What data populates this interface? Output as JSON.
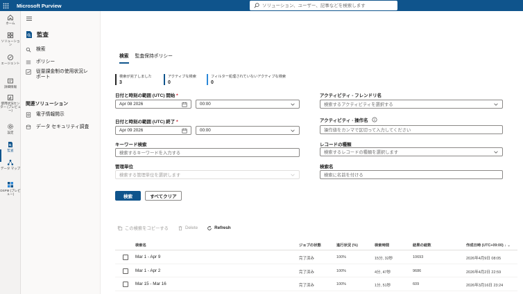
{
  "app": {
    "title": "Microsoft Purview"
  },
  "search": {
    "placeholder": "ソリューション、ユーザー、記事などを検索します"
  },
  "rail": [
    {
      "label": "ホーム",
      "icon": "home-icon"
    },
    {
      "label": "ソリューション",
      "icon": "solutions-icon"
    },
    {
      "label": "エージェント",
      "icon": "agent-icon"
    },
    {
      "label": "詳細情報",
      "icon": "learn-icon"
    },
    {
      "label": "使用状況センター (プレビュー)",
      "icon": "usage-icon"
    },
    {
      "label": "設定",
      "icon": "settings-icon"
    },
    {
      "label": "監査",
      "icon": "audit-icon"
    },
    {
      "label": "データ マップ",
      "icon": "data-map-icon"
    },
    {
      "label": "DSPM (プレビュー)",
      "icon": "dspm-icon"
    }
  ],
  "nav": {
    "title": "監査",
    "items": [
      "検索",
      "ポリシー",
      "従量課金制の使用状況レポート"
    ],
    "section": "関連ソリューション",
    "related": [
      "電子情報開示",
      "データ セキュリティ調査"
    ]
  },
  "tabs": [
    "検索",
    "監査保持ポリシー"
  ],
  "stats": [
    {
      "label": "検索が完了しました",
      "value": "3"
    },
    {
      "label": "アクティブな検索",
      "value": "0"
    },
    {
      "label": "フィルター処理されていないアクティブな検索",
      "value": "0"
    }
  ],
  "form": {
    "start_label": "日付と時刻の範囲 (UTC) 開始",
    "start_date": "Apr 08 2026",
    "start_time": "00:00",
    "end_label": "日付と時刻の範囲 (UTC) 終了",
    "end_date": "Apr 09 2026",
    "end_time": "00:00",
    "required_mark": "*",
    "keyword_label": "キーワード検索",
    "keyword_placeholder": "検索するキーワードを入力する",
    "admin_label": "管理単位",
    "admin_placeholder": "検索する管理単位を選択します",
    "activity_friendly_label": "アクティビティ - フレンドリ名",
    "activity_friendly_placeholder": "検索するアクティビティを選択する",
    "activity_op_label": "アクティビティ - 操作名",
    "activity_op_placeholder": "操作値をカンマで区切って入力してください",
    "record_label": "レコードの種類",
    "record_placeholder": "検索するレコードの種類を選択します",
    "search_name_label": "検索名",
    "search_name_placeholder": "検索に名前を付ける",
    "search_button": "検索",
    "clear_button": "すべてクリア"
  },
  "commands": {
    "copy": "この検索をコピーする",
    "delete": "Delete",
    "refresh": "Refresh"
  },
  "table": {
    "headers": [
      "検索名",
      "ジョブの状態",
      "進行状況 (%)",
      "検索時間",
      "結果の総数",
      "作成日時 (UTC+09:00)"
    ],
    "rows": [
      {
        "name": "Mar 1 - Apr 9",
        "status": "完了済み",
        "progress": "100%",
        "duration": "15分, 32秒",
        "total": "10693",
        "created": "2026年4月9日 08:05"
      },
      {
        "name": "Mar 1 - Apr 2",
        "status": "完了済み",
        "progress": "100%",
        "duration": "4分, 47秒",
        "total": "9686",
        "created": "2026年4月2日 22:59"
      },
      {
        "name": "Mar 15 - Mar 16",
        "status": "完了済み",
        "progress": "100%",
        "duration": "1分, 51秒",
        "total": "609",
        "created": "2026年3月16日 23:24"
      }
    ]
  }
}
